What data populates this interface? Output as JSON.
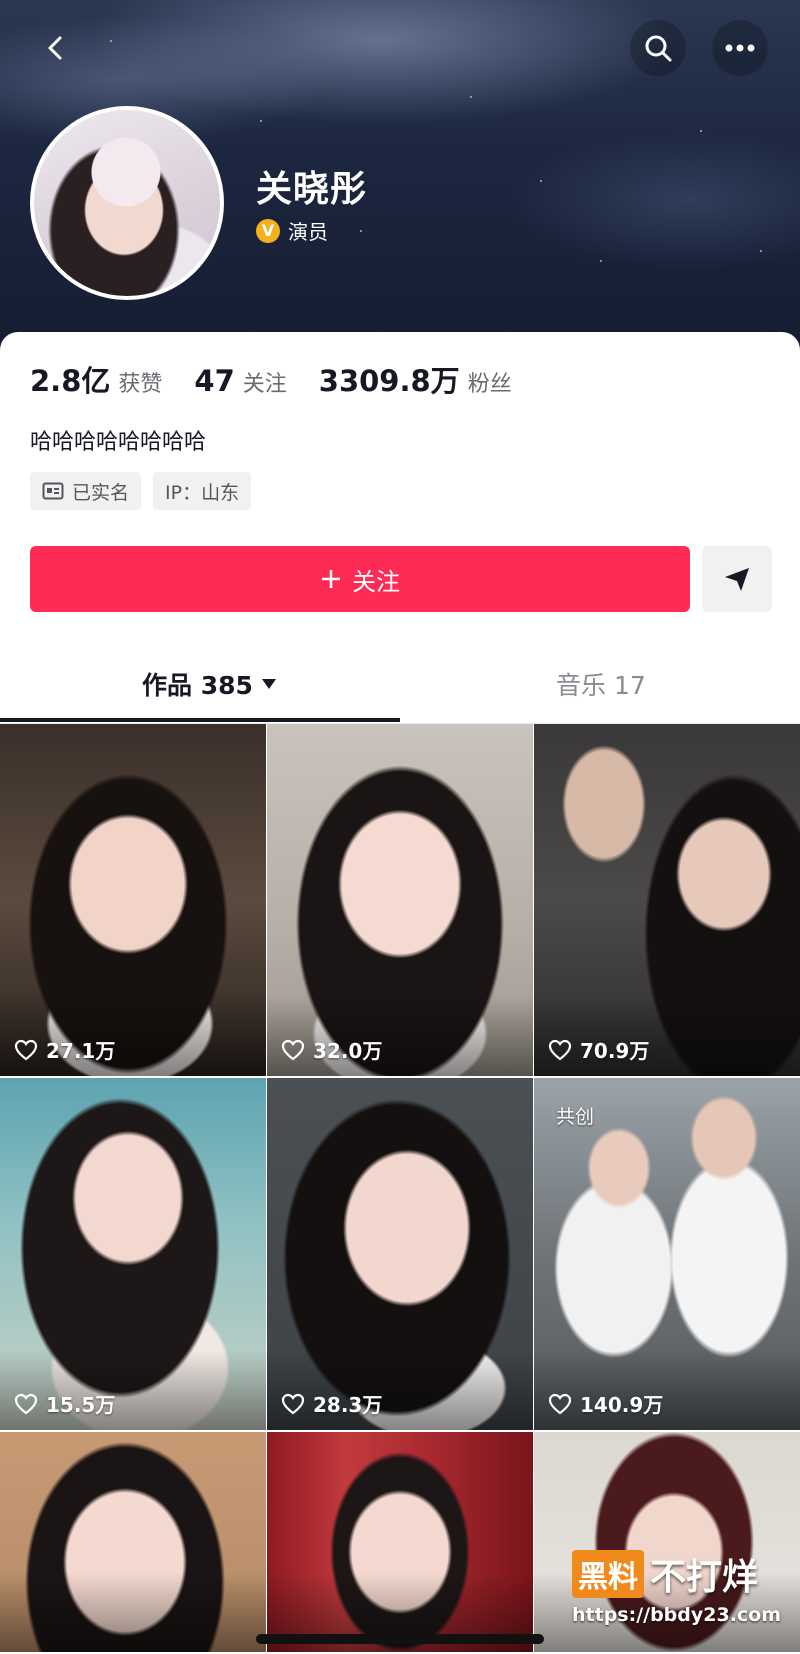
{
  "header": {
    "name": "关晓彤",
    "verify_badge": "V",
    "verify_label": "演员"
  },
  "stats": [
    {
      "value": "2.8亿",
      "label": "获赞"
    },
    {
      "value": "47",
      "label": "关注"
    },
    {
      "value": "3309.8万",
      "label": "粉丝"
    }
  ],
  "bio": "哈哈哈哈哈哈哈哈",
  "tags": {
    "verified": "已实名",
    "ip": "IP：山东"
  },
  "actions": {
    "follow_label": "关注",
    "follow_color": "#fe2c55"
  },
  "tabs": {
    "works": "作品 385",
    "music": "音乐 17"
  },
  "videos": [
    {
      "likes": "27.1万"
    },
    {
      "likes": "32.0万"
    },
    {
      "likes": "70.9万"
    },
    {
      "likes": "15.5万"
    },
    {
      "likes": "28.3万"
    },
    {
      "likes": "140.9万",
      "badge": "共创"
    },
    {
      "likes": ""
    },
    {
      "likes": ""
    },
    {
      "likes": ""
    }
  ],
  "watermark": {
    "logo_box": "黑料",
    "logo_text": "不打烊",
    "url": "https://bbdy23.com"
  },
  "icons": [
    "back-icon",
    "search-icon",
    "more-icon",
    "verified-icon",
    "id-card-icon",
    "plus-icon",
    "share-icon",
    "dropdown-icon",
    "heart-icon"
  ]
}
